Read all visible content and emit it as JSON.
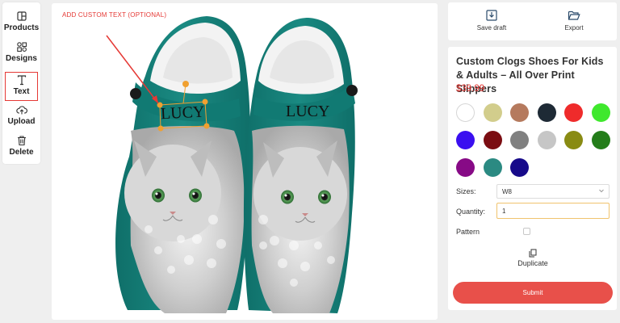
{
  "toolbar": {
    "items": [
      {
        "label": "Products",
        "icon": "products-icon"
      },
      {
        "label": "Designs",
        "icon": "designs-icon"
      },
      {
        "label": "Text",
        "icon": "text-icon",
        "active": true
      },
      {
        "label": "Upload",
        "icon": "upload-icon"
      },
      {
        "label": "Delete",
        "icon": "trash-icon"
      }
    ]
  },
  "canvas": {
    "hint": "ADD CUSTOM TEXT (OPTIONAL)",
    "left_text": "LUCY",
    "right_text": "LUCY"
  },
  "actions": {
    "save_label": "Save draft",
    "export_label": "Export"
  },
  "product": {
    "title": "Custom Clogs Shoes For Kids & Adults – All Over Print Slippers",
    "price": "$39.99",
    "colors": [
      "#ffffff",
      "#d2cd8c",
      "#b57a5e",
      "#1e2a35",
      "#ef2b2b",
      "#3fe82d",
      "#3a0ff0",
      "#7b0d12",
      "#808080",
      "#c6c6c6",
      "#898b13",
      "#247d1a",
      "#870a86",
      "#2b8a82",
      "#170a8a"
    ],
    "sizes_label": "Sizes:",
    "size_value": "W8",
    "quantity_label": "Quantity:",
    "quantity_value": "1",
    "pattern_label": "Pattern",
    "duplicate_label": "Duplicate",
    "submit_label": "Submit"
  },
  "accent": "#e53935",
  "shoe_color": "#16837c"
}
